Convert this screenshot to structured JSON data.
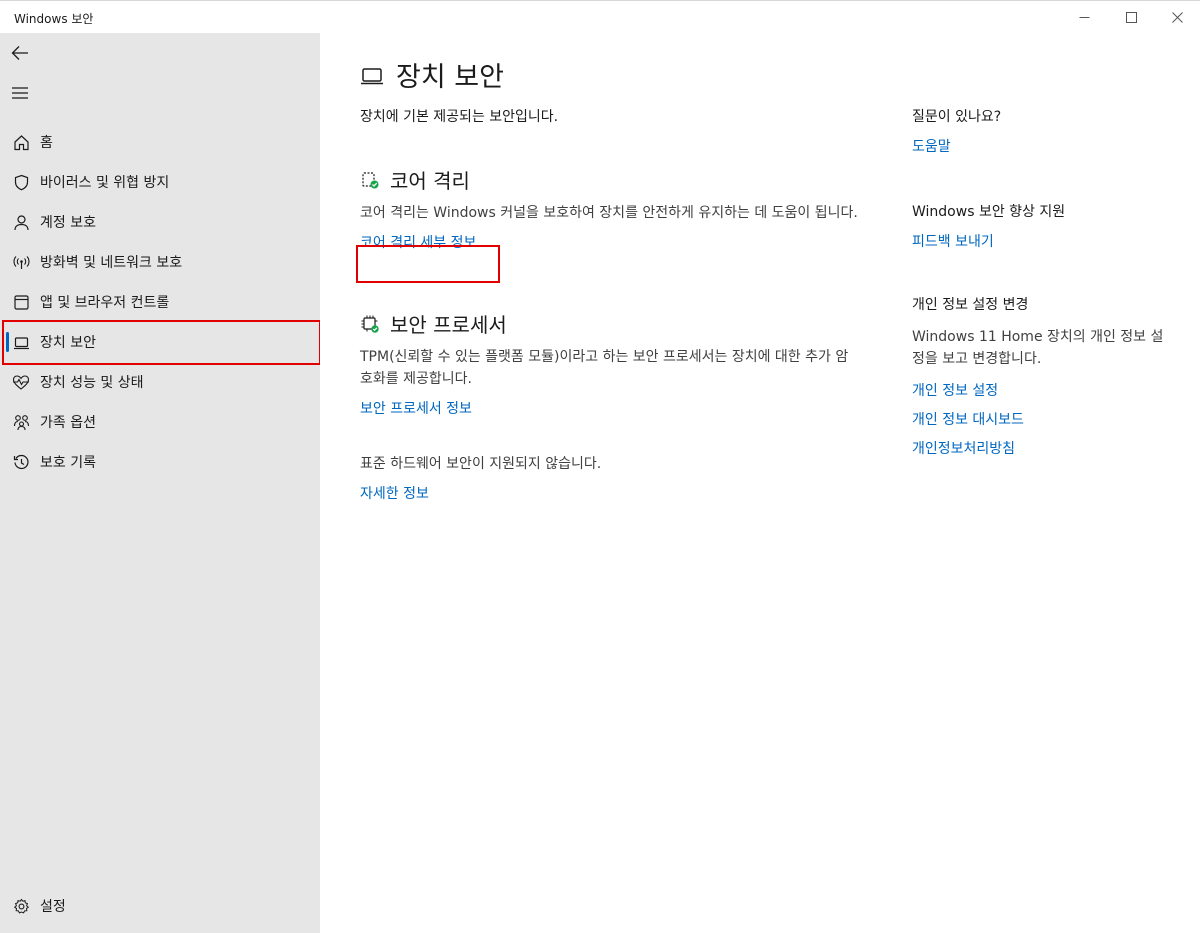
{
  "window": {
    "title": "Windows 보안"
  },
  "sidebar": {
    "items": [
      {
        "label": "홈",
        "icon": "home-icon"
      },
      {
        "label": "바이러스 및 위협 방지",
        "icon": "shield-icon"
      },
      {
        "label": "계정 보호",
        "icon": "person-icon"
      },
      {
        "label": "방화벽 및 네트워크 보호",
        "icon": "wifi-antenna-icon"
      },
      {
        "label": "앱 및 브라우저 컨트롤",
        "icon": "app-window-icon"
      },
      {
        "label": "장치 보안",
        "icon": "laptop-icon",
        "active": true
      },
      {
        "label": "장치 성능 및 상태",
        "icon": "heart-pulse-icon"
      },
      {
        "label": "가족 옵션",
        "icon": "family-icon"
      },
      {
        "label": "보호 기록",
        "icon": "history-icon"
      }
    ],
    "settings_label": "설정"
  },
  "main": {
    "title": "장치 보안",
    "subtitle": "장치에 기본 제공되는 보안입니다.",
    "core_isolation": {
      "heading": "코어 격리",
      "description": "코어 격리는 Windows 커널을 보호하여 장치를 안전하게 유지하는 데 도움이 됩니다.",
      "link": "코어 격리 세부 정보"
    },
    "security_processor": {
      "heading": "보안 프로세서",
      "description": "TPM(신뢰할 수 있는 플랫폼 모듈)이라고 하는 보안 프로세서는 장치에 대한 추가 암호화를 제공합니다.",
      "link": "보안 프로세서 정보"
    },
    "hardware_security": {
      "description": "표준 하드웨어 보안이 지원되지 않습니다.",
      "link": "자세한 정보"
    }
  },
  "side": {
    "questions": {
      "heading": "질문이 있나요?",
      "link": "도움말"
    },
    "improve": {
      "heading": "Windows 보안 향상 지원",
      "link": "피드백 보내기"
    },
    "privacy": {
      "heading": "개인 정보 설정 변경",
      "text": "Windows 11 Home 장치의 개인 정보 설정을 보고 변경합니다.",
      "links": [
        "개인 정보 설정",
        "개인 정보 대시보드",
        "개인정보처리방침"
      ]
    }
  },
  "colors": {
    "accent": "#0067c0",
    "highlight": "#e00000",
    "sidebar_bg": "#e6e6e6",
    "success": "#16a34a"
  }
}
